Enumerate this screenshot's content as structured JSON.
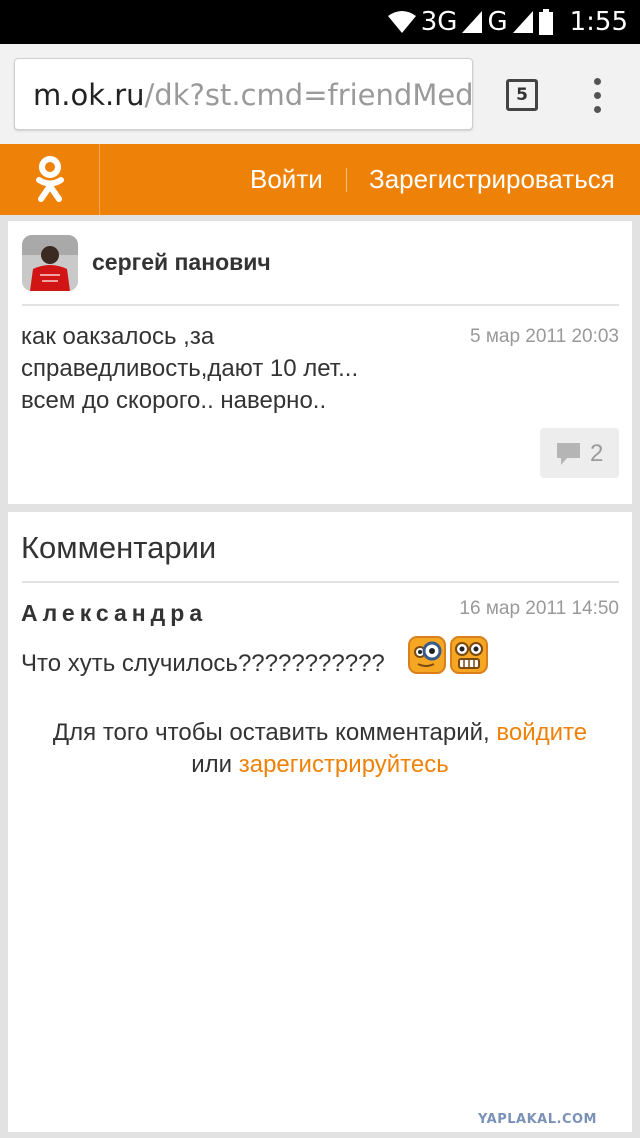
{
  "status_bar": {
    "network_label": "3G",
    "network_label_2": "G",
    "time": "1:55",
    "icons": [
      "wifi-icon",
      "signal-icon",
      "signal-icon",
      "battery-icon"
    ]
  },
  "browser": {
    "url_host": "m.ok.ru",
    "url_path": "/dk?st.cmd=friendMedia",
    "tab_count": "5",
    "icons": [
      "tabs-icon",
      "overflow-menu-icon"
    ]
  },
  "header": {
    "logo": "odnoklassniki-logo-icon",
    "login_label": "Войти",
    "register_label": "Зарегистрироваться",
    "accent_color": "#ee8208"
  },
  "post": {
    "author": "сергей панович",
    "text_lines": [
      "как оакзалось ,за",
      "справедливость,дают 10 лет...",
      "всем до скорого.. наверно.."
    ],
    "date": "5 мар 2011 20:03",
    "comment_count": "2",
    "icons": [
      "avatar",
      "comment-bubble-icon"
    ]
  },
  "comments": {
    "title": "Комментарии",
    "items": [
      {
        "author": "Александра",
        "date": "16 мар 2011 14:50",
        "text": "Что хуть случилось???????????",
        "icons": [
          "smiley-magnifier-icon",
          "smiley-grin-icon"
        ]
      }
    ],
    "prompt_before": "Для того чтобы оставить комментарий,",
    "prompt_login_link": "войдите",
    "prompt_middle": "или",
    "prompt_register_link": "зарегистрируйтесь"
  },
  "watermark": "YAPLAKAL.COM"
}
